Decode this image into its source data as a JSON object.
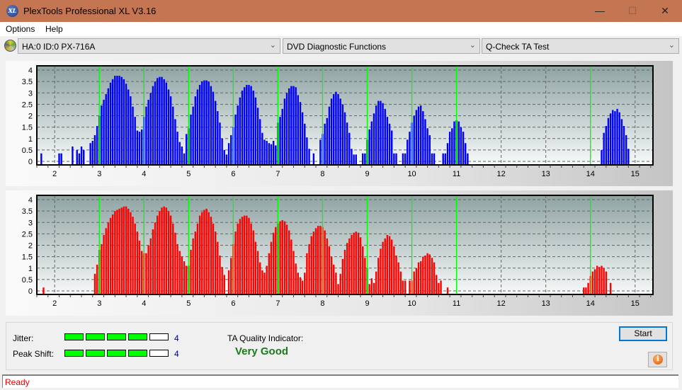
{
  "window": {
    "title": "PlexTools Professional XL V3.16",
    "app_icon": "XL",
    "minimize_icon": "minimize-icon",
    "maximize_icon": "maximize-icon",
    "close_icon": "close-icon"
  },
  "menu": {
    "items": [
      "Options",
      "Help"
    ]
  },
  "toolbar": {
    "drive_select": "HA:0 ID:0  PX-716A",
    "function_select": "DVD Diagnostic Functions",
    "test_select": "Q-Check TA Test"
  },
  "colors": {
    "bar_top": "#0000ff",
    "bar_bottom": "#ff0000",
    "marker": "#00ff00",
    "quality": "#1d7a1d",
    "status": "#e00000"
  },
  "chart_data": [
    {
      "type": "bar",
      "name": "top",
      "x_start": 1.65,
      "x_step": 0.05,
      "xlim": [
        1.6,
        15.4
      ],
      "ylim": [
        0,
        4
      ],
      "yticks": [
        "0",
        "0.5",
        "1",
        "1.5",
        "2",
        "2.5",
        "3",
        "3.5",
        "4"
      ],
      "xticks": [
        "2",
        "3",
        "4",
        "5",
        "6",
        "7",
        "8",
        "9",
        "10",
        "11",
        "12",
        "13",
        "14",
        "15"
      ],
      "markers": [
        3,
        4,
        5,
        6,
        7,
        8,
        9,
        10,
        11,
        14
      ],
      "grid": true,
      "values": [
        0,
        0.35,
        0,
        0,
        0,
        0,
        0,
        0,
        0,
        0.35,
        0.35,
        0,
        0,
        0,
        0,
        0.65,
        0,
        0.5,
        0.35,
        0.65,
        0.5,
        0,
        0,
        0.8,
        0.9,
        1.15,
        1.55,
        2.0,
        2.45,
        2.7,
        2.95,
        3.2,
        3.45,
        3.6,
        3.75,
        3.75,
        3.75,
        3.7,
        3.6,
        3.4,
        3.15,
        2.85,
        2.4,
        1.95,
        1.35,
        1.3,
        1.4,
        1.95,
        2.4,
        2.7,
        3.0,
        3.3,
        3.5,
        3.65,
        3.7,
        3.7,
        3.6,
        3.45,
        3.15,
        2.85,
        2.4,
        1.85,
        1.3,
        0.85,
        0.65,
        0.35,
        1.2,
        1.45,
        2.05,
        2.4,
        2.85,
        3.15,
        3.35,
        3.5,
        3.55,
        3.55,
        3.5,
        3.3,
        3.05,
        2.65,
        2.2,
        1.7,
        1.0,
        0.5,
        0.3,
        0.8,
        1.15,
        1.5,
        2.05,
        2.45,
        2.8,
        3.1,
        3.25,
        3.35,
        3.35,
        3.3,
        3.1,
        2.8,
        2.35,
        1.85,
        1.25,
        0.95,
        0.9,
        0.8,
        0.75,
        0.9,
        0.7,
        1.7,
        1.95,
        2.3,
        2.75,
        3.0,
        3.2,
        3.3,
        3.3,
        3.25,
        2.9,
        2.6,
        2.15,
        1.65,
        1.05,
        0.55,
        0,
        0.35,
        0,
        0,
        0.95,
        1.2,
        1.65,
        1.9,
        2.4,
        2.75,
        2.95,
        3.05,
        2.95,
        2.75,
        2.5,
        2.15,
        1.7,
        1.25,
        0.55,
        0.3,
        0.3,
        0,
        0,
        0.35,
        0.35,
        0.95,
        1.4,
        1.75,
        2.1,
        2.45,
        2.65,
        2.65,
        2.55,
        2.3,
        1.95,
        1.65,
        1.35,
        0.35,
        0.35,
        0,
        0,
        0.35,
        0.35,
        0.95,
        1.3,
        1.7,
        2.0,
        2.25,
        2.4,
        2.45,
        2.2,
        1.85,
        1.45,
        1.15,
        0.35,
        0.35,
        0,
        0,
        0,
        0.35,
        0.35,
        0.8,
        1.3,
        1.45,
        1.75,
        1.8,
        1.75,
        1.5,
        1.3,
        0.8,
        0.35,
        0,
        0,
        0,
        0,
        0,
        0,
        0,
        0,
        0,
        0,
        0,
        0,
        0,
        0,
        0,
        0,
        0,
        0,
        0,
        0,
        0,
        0,
        0,
        0,
        0,
        0,
        0,
        0,
        0,
        0,
        0,
        0,
        0,
        0,
        0,
        0,
        0,
        0,
        0,
        0,
        0,
        0,
        0,
        0,
        0,
        0,
        0,
        0,
        0,
        0,
        0,
        0,
        0,
        0,
        0,
        0,
        0,
        0,
        0,
        0.5,
        1.25,
        1.55,
        1.9,
        2.1,
        2.25,
        2.2,
        2.3,
        2.15,
        1.85,
        1.55,
        1.15,
        0.55,
        0,
        0,
        0,
        0,
        0,
        0,
        0,
        0,
        0,
        0,
        0,
        0,
        0,
        0,
        0
      ]
    },
    {
      "type": "bar",
      "name": "bottom",
      "x_start": 1.65,
      "x_step": 0.05,
      "xlim": [
        1.6,
        15.4
      ],
      "ylim": [
        0,
        4
      ],
      "yticks": [
        "0",
        "0.5",
        "1",
        "1.5",
        "2",
        "2.5",
        "3",
        "3.5",
        "4"
      ],
      "xticks": [
        "2",
        "3",
        "4",
        "5",
        "6",
        "7",
        "8",
        "9",
        "10",
        "11",
        "12",
        "13",
        "14",
        "15"
      ],
      "markers": [
        3,
        4,
        5,
        6,
        7,
        8,
        9,
        10,
        11,
        14
      ],
      "grid": true,
      "values": [
        0,
        0,
        0.15,
        0,
        0,
        0,
        0,
        0,
        0,
        0,
        0,
        0,
        0,
        0,
        0,
        0,
        0,
        0,
        0,
        0,
        0,
        0,
        0,
        0,
        0,
        0.75,
        1.15,
        1.8,
        2.05,
        2.45,
        2.75,
        3.0,
        3.2,
        3.35,
        3.5,
        3.55,
        3.6,
        3.65,
        3.7,
        3.7,
        3.6,
        3.45,
        3.25,
        2.95,
        2.6,
        2.2,
        1.75,
        1.65,
        1.65,
        2.0,
        2.3,
        2.7,
        3.0,
        3.3,
        3.5,
        3.65,
        3.7,
        3.65,
        3.5,
        3.3,
        2.95,
        2.55,
        2.05,
        1.75,
        1.5,
        1.3,
        1.1,
        1.1,
        1.8,
        2.3,
        2.6,
        2.95,
        3.3,
        3.45,
        3.55,
        3.6,
        3.45,
        3.25,
        2.95,
        2.6,
        2.15,
        1.55,
        1.05,
        0.7,
        0,
        0.9,
        1.45,
        2.05,
        2.6,
        2.95,
        3.15,
        3.25,
        3.3,
        3.3,
        3.2,
        2.95,
        2.65,
        2.15,
        1.75,
        1.25,
        0.9,
        0.8,
        1.1,
        1.65,
        2.15,
        2.55,
        2.8,
        2.95,
        3.05,
        3.1,
        3.05,
        2.9,
        2.65,
        2.25,
        1.75,
        1.2,
        0.8,
        0.6,
        0.45,
        0.8,
        1.65,
        2.05,
        2.4,
        2.6,
        2.75,
        2.85,
        2.85,
        2.8,
        2.65,
        2.3,
        1.95,
        1.5,
        1.15,
        0.8,
        0.3,
        0.75,
        1.4,
        1.8,
        2.1,
        2.3,
        2.45,
        2.55,
        2.6,
        2.55,
        2.35,
        1.95,
        1.45,
        1.0,
        0.3,
        0.55,
        0.35,
        0.85,
        1.45,
        1.85,
        2.15,
        2.3,
        2.45,
        2.4,
        2.25,
        1.95,
        1.55,
        1.25,
        0.85,
        0.45,
        0.45,
        0,
        0.45,
        0.45,
        0.85,
        1.0,
        1.25,
        1.3,
        1.5,
        1.55,
        1.65,
        1.6,
        1.45,
        1.25,
        0.7,
        0.35,
        0.45,
        0,
        0,
        0.15,
        0,
        0,
        0,
        0,
        0,
        0,
        0,
        0,
        0,
        0,
        0,
        0,
        0,
        0,
        0,
        0,
        0,
        0,
        0,
        0,
        0,
        0,
        0,
        0,
        0,
        0,
        0,
        0,
        0,
        0,
        0,
        0,
        0,
        0,
        0,
        0,
        0,
        0,
        0,
        0,
        0,
        0,
        0,
        0,
        0,
        0,
        0,
        0,
        0,
        0,
        0,
        0,
        0,
        0,
        0,
        0,
        0,
        0,
        0,
        0,
        0.15,
        0.15,
        0.35,
        0.65,
        0.85,
        0.95,
        1.1,
        1.05,
        1.1,
        1.0,
        0.85,
        0,
        0.35,
        0,
        0,
        0,
        0,
        0,
        0,
        0,
        0,
        0,
        0,
        0,
        0
      ]
    }
  ],
  "results": {
    "jitter_label": "Jitter:",
    "jitter_value": "4",
    "jitter_level": 4,
    "peak_shift_label": "Peak Shift:",
    "peak_shift_value": "4",
    "peak_shift_level": 4,
    "meter_max": 5,
    "ta_quality_label": "TA Quality Indicator:",
    "ta_quality_value": "Very Good"
  },
  "buttons": {
    "start": "Start",
    "info_icon": "i"
  },
  "status": {
    "text": "Ready"
  }
}
